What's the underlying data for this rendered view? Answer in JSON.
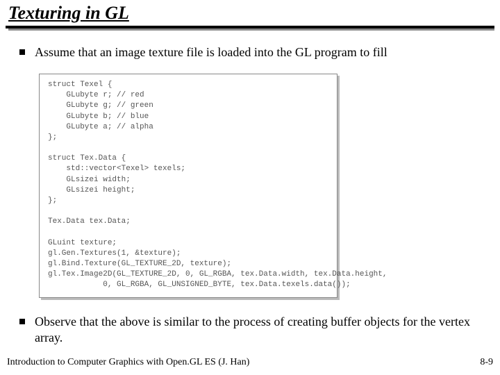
{
  "title": "Texturing in GL",
  "bullets": {
    "b1": "Assume that an image texture file is loaded into the GL program to fill",
    "b2": "Observe that the above is similar to the process of creating buffer objects for the vertex array."
  },
  "code": "struct Texel {\n    GLubyte r; // red\n    GLubyte g; // green\n    GLubyte b; // blue\n    GLubyte a; // alpha\n};\n\nstruct Tex.Data {\n    std::vector<Texel> texels;\n    GLsizei width;\n    GLsizei height;\n};\n\nTex.Data tex.Data;\n\nGLuint texture;\ngl.Gen.Textures(1, &texture);\ngl.Bind.Texture(GL_TEXTURE_2D, texture);\ngl.Tex.Image2D(GL_TEXTURE_2D, 0, GL_RGBA, tex.Data.width, tex.Data.height,\n            0, GL_RGBA, GL_UNSIGNED_BYTE, tex.Data.texels.data());",
  "footer": {
    "left": "Introduction to Computer Graphics with Open.GL ES (J. Han)",
    "right": "8-9"
  }
}
